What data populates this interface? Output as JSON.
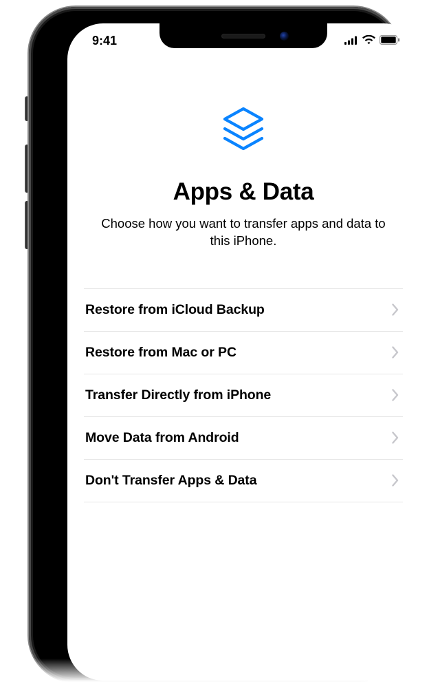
{
  "status": {
    "time": "9:41"
  },
  "page": {
    "title": "Apps & Data",
    "subtitle": "Choose how you want to transfer apps and data to this iPhone."
  },
  "options": [
    {
      "label": "Restore from iCloud Backup"
    },
    {
      "label": "Restore from Mac or PC"
    },
    {
      "label": "Transfer Directly from iPhone"
    },
    {
      "label": "Move Data from Android"
    },
    {
      "label": "Don't Transfer Apps & Data"
    }
  ],
  "colors": {
    "accent": "#0a84ff"
  }
}
